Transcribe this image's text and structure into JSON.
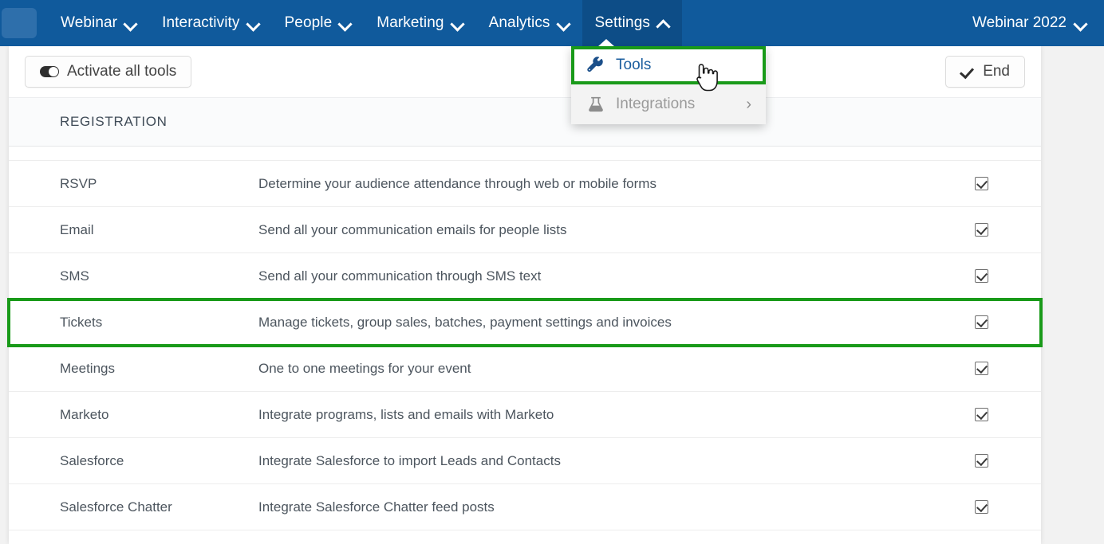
{
  "navbar": {
    "logo_icon": "app-logo",
    "items": [
      {
        "label": "Webinar",
        "icon": "chevron-down-icon",
        "active": false
      },
      {
        "label": "Interactivity",
        "icon": "chevron-down-icon",
        "active": false
      },
      {
        "label": "People",
        "icon": "chevron-down-icon",
        "active": false
      },
      {
        "label": "Marketing",
        "icon": "chevron-down-icon",
        "active": false
      },
      {
        "label": "Analytics",
        "icon": "chevron-down-icon",
        "active": false
      },
      {
        "label": "Settings",
        "icon": "chevron-up-icon",
        "active": true
      }
    ],
    "account": {
      "label": "Webinar 2022",
      "icon": "chevron-down-icon"
    },
    "bg_color": "#105a9c",
    "active_bg_color": "#0d4d87"
  },
  "dropdown": {
    "items": [
      {
        "label": "Tools",
        "icon": "wrench-icon",
        "highlighted": true,
        "disabled": false,
        "submenu_icon": ""
      },
      {
        "label": "Integrations",
        "icon": "flask-icon",
        "highlighted": false,
        "disabled": true,
        "submenu_icon": "chevron-right-icon"
      }
    ],
    "highlight_color": "#199a19"
  },
  "cursor": {
    "icon": "pointing-hand-cursor"
  },
  "toolbar": {
    "activate_all_label": "Activate all tools",
    "activate_all_icon": "toggle-switch-icon",
    "end_label": "End",
    "end_icon": "checkmark-icon"
  },
  "section": {
    "title": "REGISTRATION"
  },
  "table": {
    "rows": [
      {
        "name": "RSVP",
        "description": "Determine your audience attendance through web or mobile forms",
        "checked": true,
        "highlighted": false
      },
      {
        "name": "Email",
        "description": "Send all your communication emails for people lists",
        "checked": true,
        "highlighted": false
      },
      {
        "name": "SMS",
        "description": "Send all your communication through SMS text",
        "checked": true,
        "highlighted": false
      },
      {
        "name": "Tickets",
        "description": "Manage tickets, group sales, batches, payment settings and invoices",
        "checked": true,
        "highlighted": true
      },
      {
        "name": "Meetings",
        "description": "One to one meetings for your event",
        "checked": true,
        "highlighted": false
      },
      {
        "name": "Marketo",
        "description": "Integrate programs, lists and emails with Marketo",
        "checked": true,
        "highlighted": false
      },
      {
        "name": "Salesforce",
        "description": "Integrate Salesforce to import Leads and Contacts",
        "checked": true,
        "highlighted": false
      },
      {
        "name": "Salesforce Chatter",
        "description": "Integrate Salesforce Chatter feed posts",
        "checked": true,
        "highlighted": false
      }
    ]
  }
}
